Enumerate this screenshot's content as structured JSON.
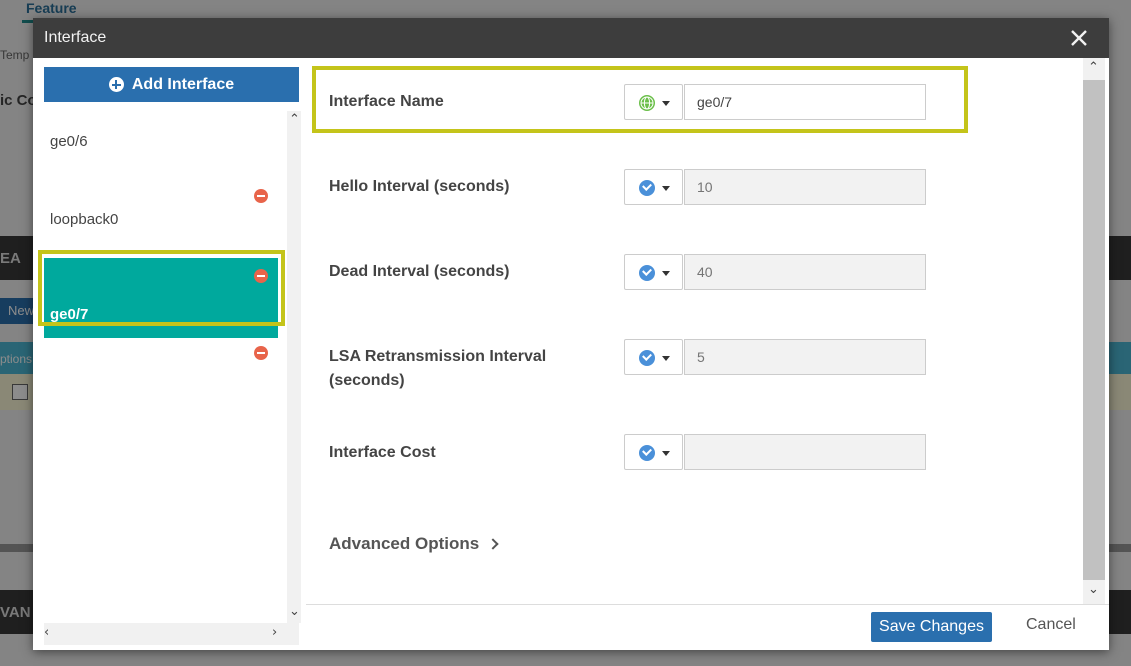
{
  "background": {
    "feature_tab": "Feature",
    "temp_text": "Temp",
    "ic_text": "ic Co",
    "ea_text": "EA",
    "new_text": "New",
    "options_text": "ptions",
    "van_text": "VAN"
  },
  "modal": {
    "title": "Interface",
    "close_label": "×"
  },
  "sidebar": {
    "add_button_label": "Add Interface",
    "items": [
      {
        "label": "ge0/6",
        "selected": false
      },
      {
        "label": "loopback0",
        "selected": false
      },
      {
        "label": "ge0/7",
        "selected": true
      }
    ]
  },
  "form": {
    "fields": [
      {
        "label": "Interface Name",
        "scope_icon": "globe-icon",
        "value": "ge0/7",
        "placeholder": ""
      },
      {
        "label": "Hello Interval (seconds)",
        "scope_icon": "check-circle-icon",
        "value": "",
        "placeholder": "10"
      },
      {
        "label": "Dead Interval (seconds)",
        "scope_icon": "check-circle-icon",
        "value": "",
        "placeholder": "40"
      },
      {
        "label": "LSA Retransmission Interval",
        "label2": "(seconds)",
        "scope_icon": "check-circle-icon",
        "value": "",
        "placeholder": "5"
      },
      {
        "label": "Interface Cost",
        "scope_icon": "check-circle-icon",
        "value": "",
        "placeholder": ""
      }
    ],
    "advanced_label": "Advanced Options"
  },
  "footer": {
    "save_label": "Save Changes",
    "cancel_label": "Cancel"
  },
  "colors": {
    "accent_blue": "#2a6fae",
    "selected_teal": "#00a99d",
    "highlight_yellow": "#c4c41a",
    "remove_red": "#e8644a"
  }
}
